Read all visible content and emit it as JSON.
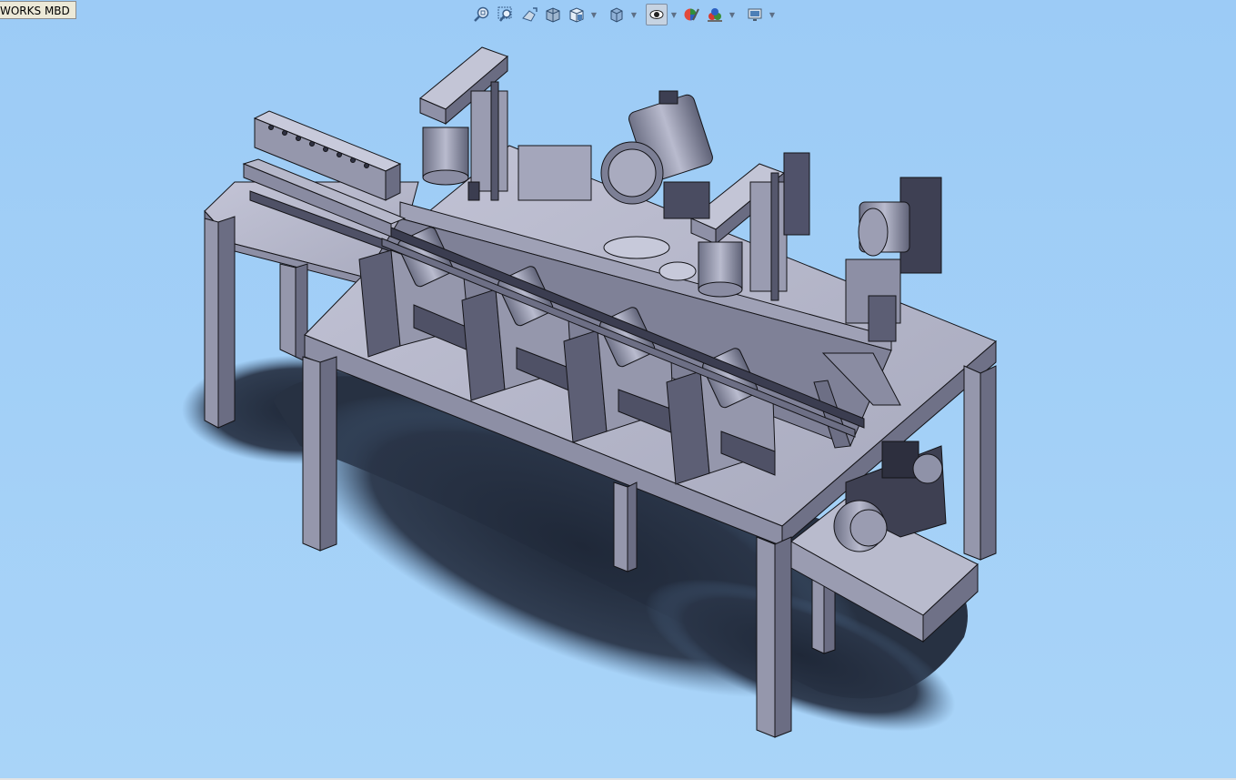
{
  "document": {
    "tab_label": "WORKS MBD"
  },
  "heads_up_toolbar": {
    "buttons": [
      {
        "name": "zoom-to-fit-icon"
      },
      {
        "name": "zoom-to-area-icon"
      },
      {
        "name": "previous-view-icon"
      },
      {
        "name": "section-view-icon"
      },
      {
        "name": "view-orientation-icon",
        "dropdown": true
      },
      {
        "name": "display-style-icon",
        "dropdown": true
      },
      {
        "name": "hide-show-items-icon",
        "dropdown": true,
        "active": true
      },
      {
        "name": "edit-appearance-icon"
      },
      {
        "name": "apply-scene-icon",
        "dropdown": true
      },
      {
        "name": "view-settings-icon",
        "dropdown": true
      }
    ]
  },
  "colors": {
    "background": "#a0cef7",
    "model": "#b0b2c6",
    "model_dark": "#5a5d72",
    "shadow": "#2a3446",
    "edge": "#141418"
  }
}
